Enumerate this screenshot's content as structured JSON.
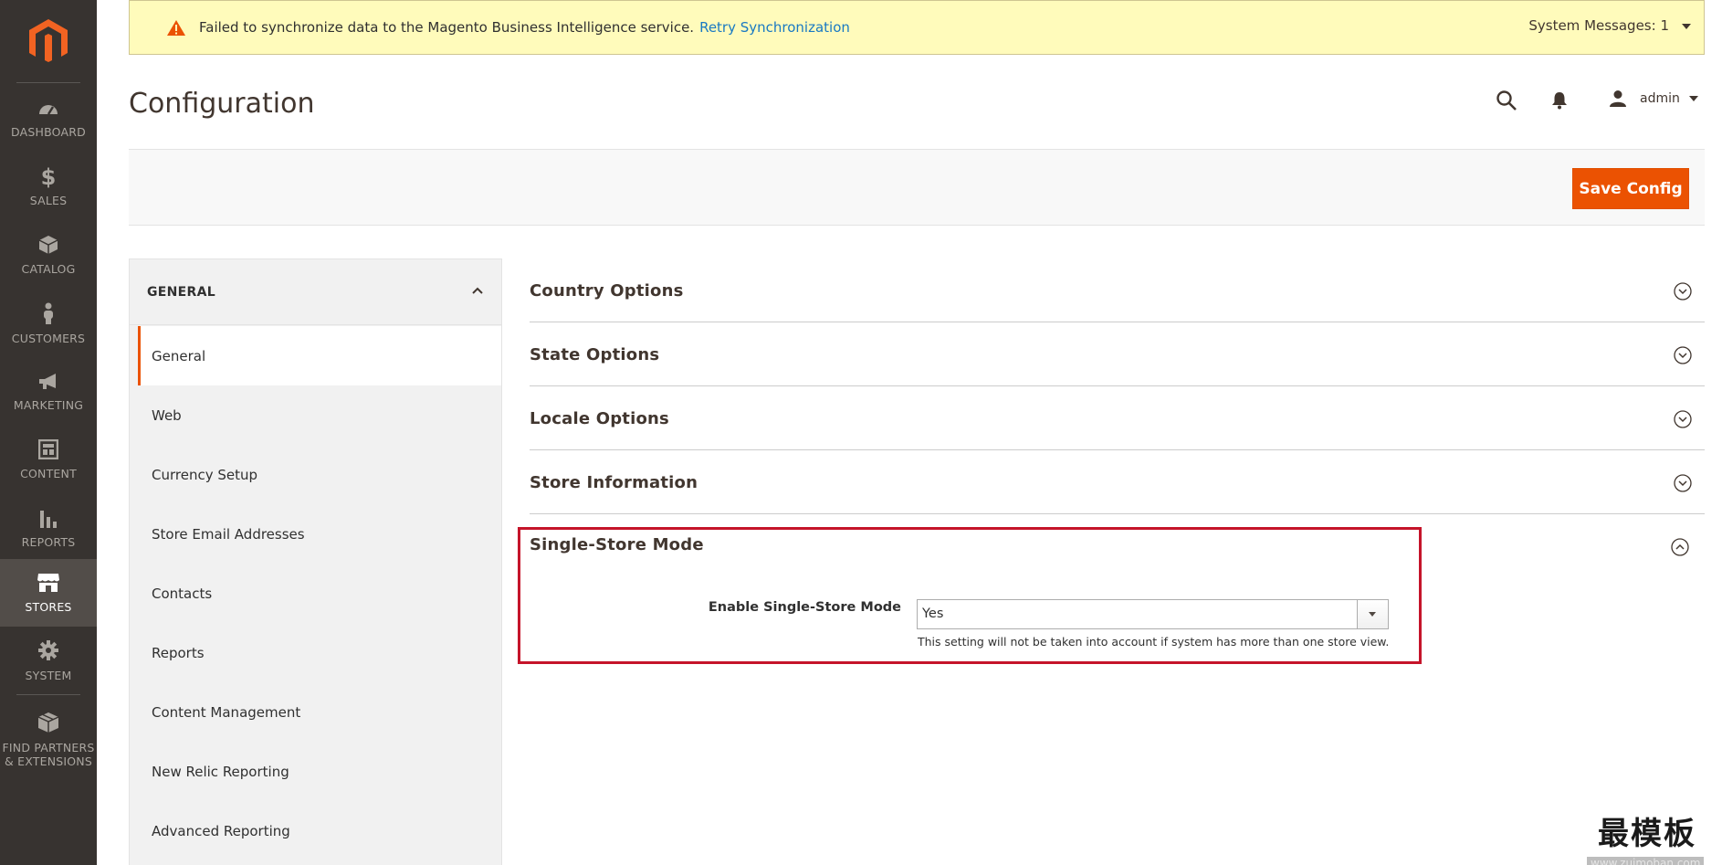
{
  "nav": {
    "items": [
      {
        "label": "DASHBOARD",
        "icon": "gauge-icon"
      },
      {
        "label": "SALES",
        "icon": "dollar-icon"
      },
      {
        "label": "CATALOG",
        "icon": "cube-icon"
      },
      {
        "label": "CUSTOMERS",
        "icon": "person-icon"
      },
      {
        "label": "MARKETING",
        "icon": "megaphone-icon"
      },
      {
        "label": "CONTENT",
        "icon": "layout-icon"
      },
      {
        "label": "REPORTS",
        "icon": "bar-chart-icon"
      },
      {
        "label": "STORES",
        "icon": "store-icon"
      },
      {
        "label": "SYSTEM",
        "icon": "gear-icon"
      },
      {
        "label": "FIND PARTNERS\n& EXTENSIONS",
        "icon": "box-icon"
      }
    ]
  },
  "system_bar": {
    "message": "Failed to synchronize data to the Magento Business Intelligence service.",
    "retry_link": "Retry Synchronization",
    "system_messages": "System Messages: 1"
  },
  "header": {
    "title": "Configuration",
    "user": "admin"
  },
  "actions": {
    "save_label": "Save Config"
  },
  "sidebar": {
    "group": "GENERAL",
    "items": [
      {
        "label": "General"
      },
      {
        "label": "Web"
      },
      {
        "label": "Currency Setup"
      },
      {
        "label": "Store Email Addresses"
      },
      {
        "label": "Contacts"
      },
      {
        "label": "Reports"
      },
      {
        "label": "Content Management"
      },
      {
        "label": "New Relic Reporting"
      },
      {
        "label": "Advanced Reporting"
      }
    ]
  },
  "sections": [
    {
      "title": "Country Options"
    },
    {
      "title": "State Options"
    },
    {
      "title": "Locale Options"
    },
    {
      "title": "Store Information"
    }
  ],
  "single_store": {
    "title": "Single-Store Mode",
    "field_label": "Enable Single-Store Mode",
    "value": "Yes",
    "note": "This setting will not be taken into account if system has more than one store view."
  },
  "watermark": {
    "cn": "最模板",
    "url": "www.zuimoban.com"
  },
  "colors": {
    "nav_bg": "#373330",
    "accent": "#eb5202",
    "highlight_border": "#c5142a",
    "link": "#1979c3"
  }
}
